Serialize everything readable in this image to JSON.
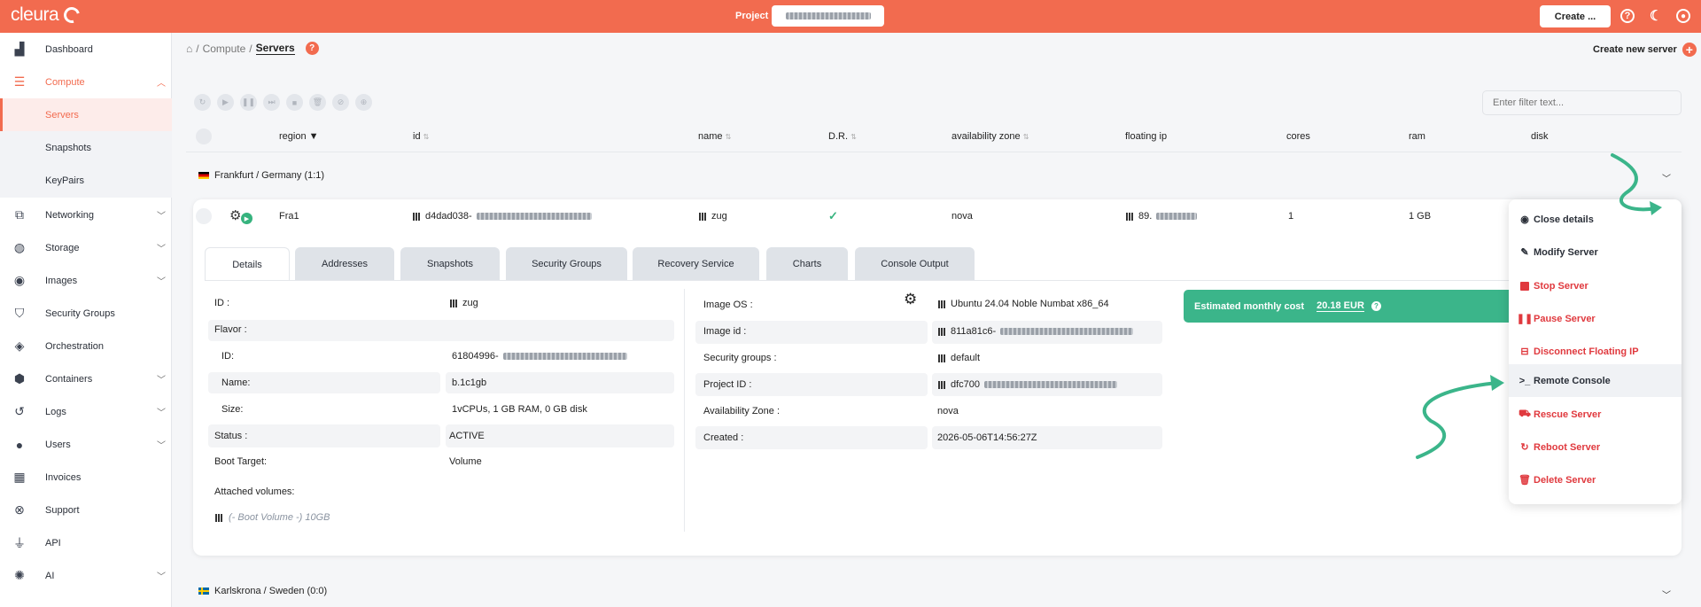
{
  "brand": "cleura",
  "topbar": {
    "project_label": "Project",
    "create_label": "Create ...",
    "help_icon": "help-icon",
    "moon_icon": "moon-icon",
    "user_icon": "user-icon"
  },
  "colors": {
    "accent": "#f26b4f",
    "success": "#3bb58a",
    "danger": "#e0393e"
  },
  "sidebar": {
    "items": [
      {
        "label": "Dashboard",
        "icon": "chart-icon"
      },
      {
        "label": "Compute",
        "icon": "server-stack-icon"
      },
      {
        "label": "Networking",
        "icon": "network-icon"
      },
      {
        "label": "Storage",
        "icon": "database-icon"
      },
      {
        "label": "Images",
        "icon": "camera-icon"
      },
      {
        "label": "Security Groups",
        "icon": "shield-icon"
      },
      {
        "label": "Orchestration",
        "icon": "layers-icon"
      },
      {
        "label": "Containers",
        "icon": "box-icon"
      },
      {
        "label": "Logs",
        "icon": "history-icon"
      },
      {
        "label": "Users",
        "icon": "user-icon"
      },
      {
        "label": "Invoices",
        "icon": "calculator-icon"
      },
      {
        "label": "Support",
        "icon": "lifebuoy-icon"
      },
      {
        "label": "API",
        "icon": "plug-icon"
      },
      {
        "label": "AI",
        "icon": "brain-icon"
      }
    ],
    "compute_sub": [
      "Servers",
      "Snapshots",
      "KeyPairs"
    ]
  },
  "breadcrumb": {
    "part1": "Compute",
    "sep": "/",
    "current": "Servers"
  },
  "create_server": "Create new server",
  "filter_placeholder": "Enter filter text...",
  "table": {
    "headers": [
      "region",
      "id",
      "name",
      "D.R.",
      "availability zone",
      "floating ip",
      "cores",
      "ram",
      "disk"
    ]
  },
  "groups": [
    "Frankfurt / Germany (1:1)",
    "Karlskrona / Sweden (0:0)"
  ],
  "server": {
    "region": "Fra1",
    "id_prefix": "d4dad038-",
    "name": "zug",
    "availability_zone": "nova",
    "floating_ip_prefix": "89.",
    "cores": "1",
    "ram": "1 GB"
  },
  "tabs": [
    "Details",
    "Addresses",
    "Snapshots",
    "Security Groups",
    "Recovery Service",
    "Charts",
    "Console Output"
  ],
  "details_left": {
    "id_label": "ID :",
    "id_value": "zug",
    "flavor_label": "Flavor :",
    "flavor_id_label": "ID:",
    "flavor_id_value": "61804996-",
    "flavor_name_label": "Name:",
    "flavor_name_value": "b.1c1gb",
    "size_label": "Size:",
    "size_value": "1vCPUs, 1 GB RAM, 0 GB disk",
    "status_label": "Status :",
    "status_value": "ACTIVE",
    "boot_label": "Boot Target:",
    "boot_value": "Volume",
    "volumes_label": "Attached volumes:",
    "volume_value": "(- Boot Volume -) 10GB"
  },
  "details_right": {
    "os_label": "Image OS :",
    "os_value": "Ubuntu 24.04 Noble Numbat x86_64",
    "image_id_label": "Image id :",
    "image_id_value": "811a81c6-",
    "sg_label": "Security groups :",
    "sg_value": "default",
    "project_label": "Project ID :",
    "project_value": "dfc700",
    "az_label": "Availability Zone :",
    "az_value": "nova",
    "created_label": "Created :",
    "created_value": "2026-05-06T14:56:27Z"
  },
  "cost": {
    "label": "Estimated monthly cost",
    "value": "20.18 EUR"
  },
  "menu": [
    {
      "label": "Close details",
      "icon": "eye-icon"
    },
    {
      "label": "Modify Server",
      "icon": "edit-icon"
    },
    {
      "label": "Stop Server",
      "icon": "stop-icon"
    },
    {
      "label": "Pause Server",
      "icon": "pause-icon"
    },
    {
      "label": "Disconnect Floating IP",
      "icon": "disconnect-icon"
    },
    {
      "label": "Remote Console",
      "icon": "terminal-icon"
    },
    {
      "label": "Rescue Server",
      "icon": "truck-icon"
    },
    {
      "label": "Reboot Server",
      "icon": "reboot-icon"
    },
    {
      "label": "Delete Server",
      "icon": "trash-icon"
    }
  ]
}
